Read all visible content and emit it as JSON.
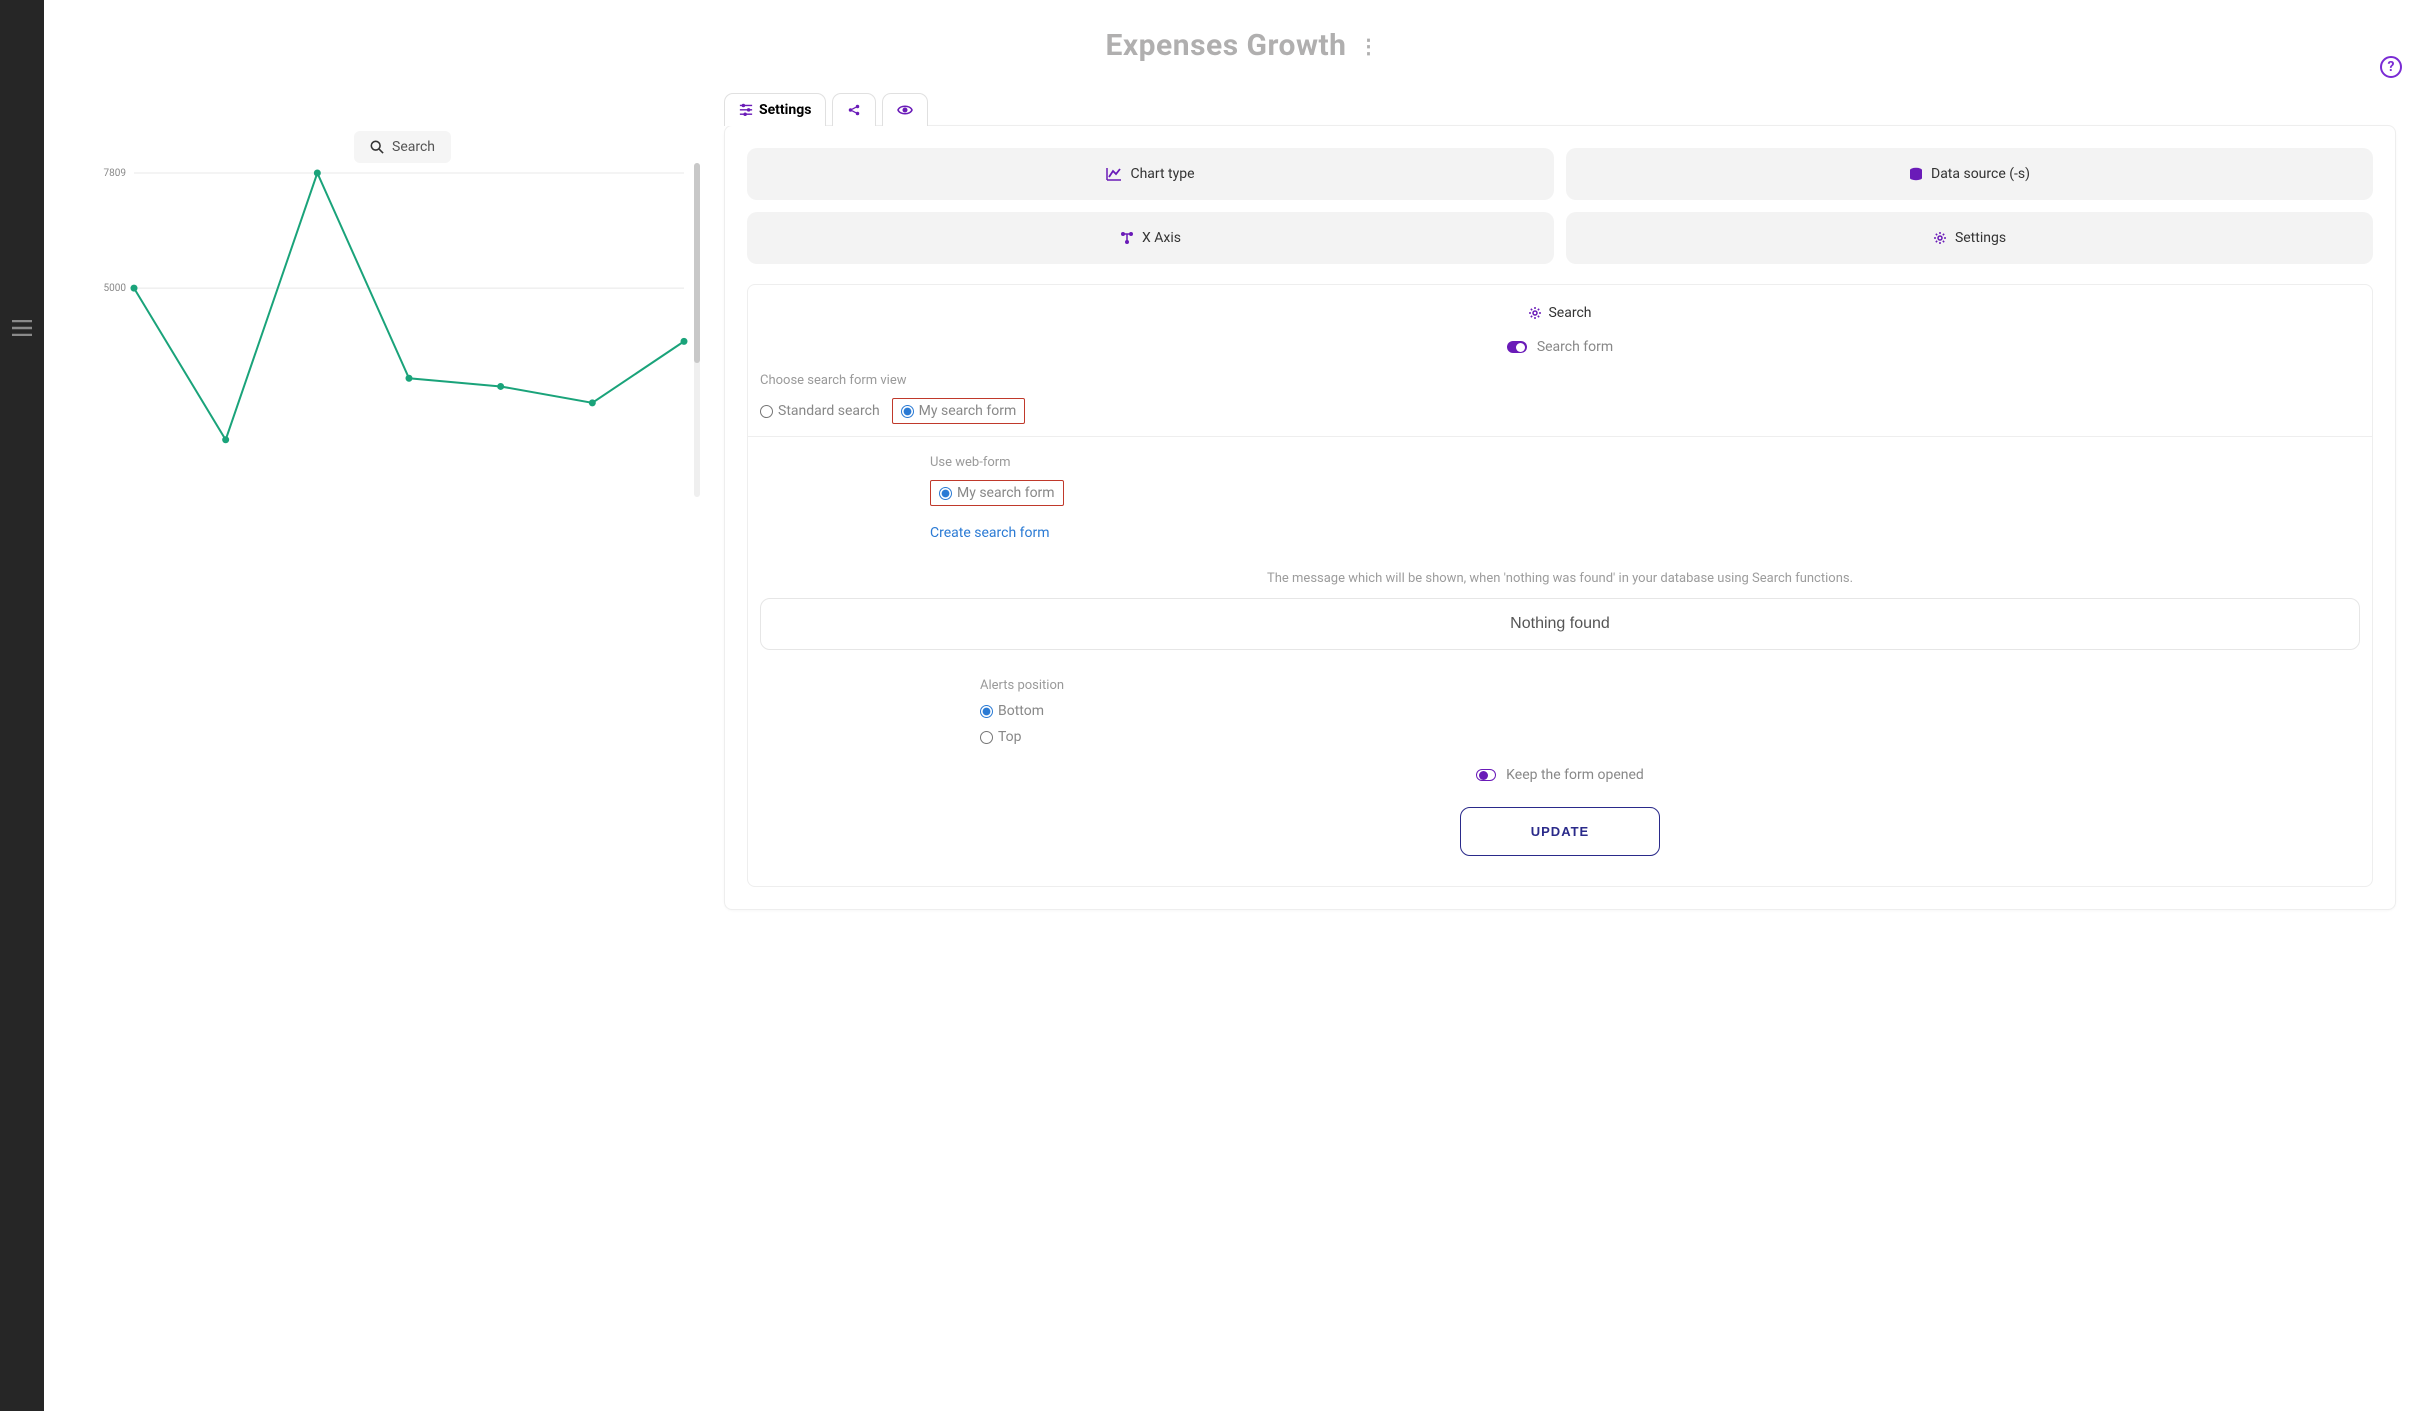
{
  "page_title": "Expenses Growth",
  "help_tooltip": "?",
  "sidebar": {
    "hamburger_label": "menu"
  },
  "search_pill": {
    "label": "Search"
  },
  "chart_data": {
    "type": "line",
    "x": [
      0,
      1,
      2,
      3,
      4,
      5,
      6
    ],
    "values": [
      5000,
      1300,
      7809,
      2800,
      2600,
      2200,
      3700
    ],
    "yticks": [
      5000,
      7809
    ],
    "ylim": [
      0,
      7809
    ],
    "color": "#1aa37a"
  },
  "tabs": [
    {
      "id": "settings",
      "label": "Settings",
      "active": true
    },
    {
      "id": "share",
      "label": ""
    },
    {
      "id": "preview",
      "label": ""
    }
  ],
  "grid_buttons": {
    "chart_type": "Chart type",
    "data_source": "Data source (-s)",
    "x_axis": "X Axis",
    "settings": "Settings"
  },
  "search_section": {
    "header": "Search",
    "toggle_search_form_label": "Search form",
    "toggle_search_form_on": true,
    "choose_form_label": "Choose search form view",
    "standard_search": "Standard search",
    "my_search_form": "My search form",
    "choose_form_selected": "my",
    "use_web_form_label": "Use web-form",
    "use_web_form_option": "My search form",
    "create_link": "Create search form",
    "nothing_found_hint": "The message which will be shown, when 'nothing was found' in your database using Search functions.",
    "nothing_found_value": "Nothing found",
    "alerts_position_label": "Alerts position",
    "alerts_bottom": "Bottom",
    "alerts_top": "Top",
    "alerts_selected": "bottom",
    "keep_open_label": "Keep the form opened",
    "keep_open_on": false,
    "update_label": "UPDATE"
  }
}
